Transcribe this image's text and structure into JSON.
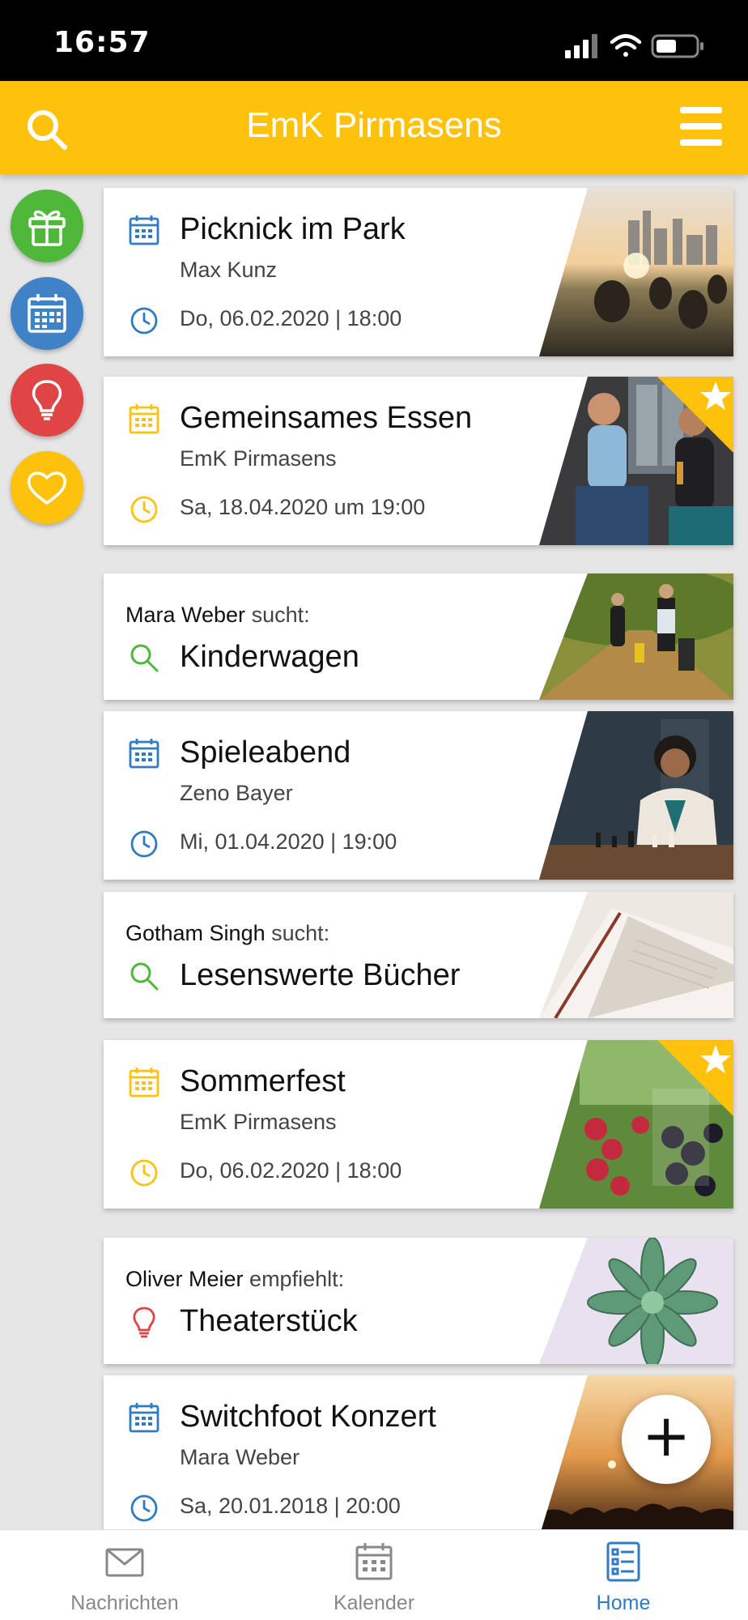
{
  "status_bar": {
    "time": "16:57"
  },
  "header": {
    "title": "EmK Pirmasens"
  },
  "categories": [
    {
      "name": "gift",
      "color": "#4fb83a"
    },
    {
      "name": "calendar",
      "color": "#3f82c8"
    },
    {
      "name": "idea",
      "color": "#e04545"
    },
    {
      "name": "heart",
      "color": "#fec20c"
    }
  ],
  "cards": [
    {
      "title": "Picknick im Park",
      "subtitle": "Max Kunz",
      "date": "Do, 06.02.2020 | 18:00"
    },
    {
      "title": "Gemeinsames Essen",
      "subtitle": "EmK Pirmasens",
      "date": "Sa, 18.04.2020 um 19:00",
      "featured": true
    },
    {
      "person": "Mara Weber",
      "verb": "sucht:",
      "title": "Kinderwagen"
    },
    {
      "title": "Spieleabend",
      "subtitle": "Zeno Bayer",
      "date": "Mi, 01.04.2020 | 19:00"
    },
    {
      "person": "Gotham Singh",
      "verb": "sucht:",
      "title": "Lesenswerte Bücher"
    },
    {
      "title": "Sommerfest",
      "subtitle": "EmK Pirmasens",
      "date": "Do, 06.02.2020 | 18:00",
      "featured": true
    },
    {
      "person": "Oliver Meier",
      "verb": "empfiehlt:",
      "title": "Theaterstück"
    },
    {
      "title": "Switchfoot Konzert",
      "subtitle": "Mara Weber",
      "date": "Sa, 20.01.2018 | 20:00"
    }
  ],
  "fab": {
    "symbol": "+"
  },
  "nav": [
    {
      "label": "Nachrichten",
      "icon": "envelope-icon"
    },
    {
      "label": "Kalender",
      "icon": "calendar-icon"
    },
    {
      "label": "Home",
      "icon": "list-icon",
      "active": true
    }
  ],
  "colors": {
    "accent": "#fec20c",
    "blue": "#2f7cc4",
    "green": "#4fb83a",
    "red": "#e04545"
  }
}
